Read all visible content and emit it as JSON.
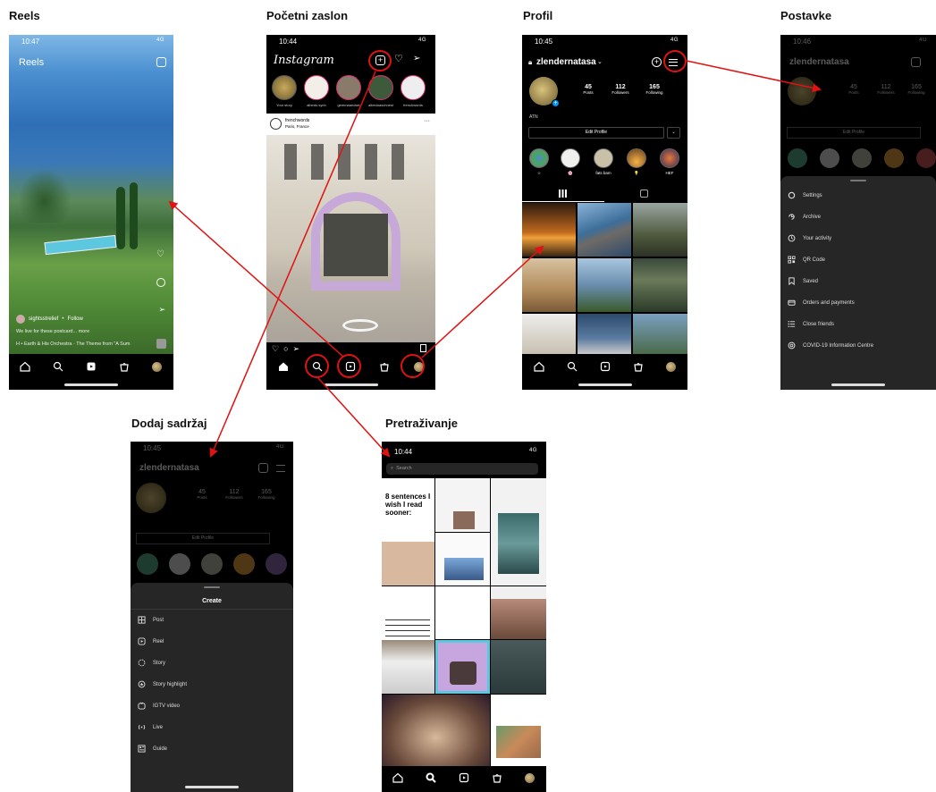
{
  "labels": {
    "reels": "Reels",
    "home": "Početni zaslon",
    "profile": "Profil",
    "settings": "Postavke",
    "add_content": "Dodaj sadržaj",
    "search": "Pretraživanje"
  },
  "reels_screen": {
    "time": "10:47",
    "signal": "4G",
    "title": "Reels",
    "username": "sightsstrelief",
    "follow": "Follow",
    "caption": "We live for these postcard... more",
    "audio": "H • Earth & His Orchestra · The Theme from \"A Sum"
  },
  "home_screen": {
    "time": "10:44",
    "signal": "4G",
    "logo": "Instagram",
    "stories": [
      "Your story",
      "albedo.syrin",
      "gemmaandwe",
      "albedoaschnest",
      "frenchwords"
    ],
    "post_user": "frenchwords",
    "post_location": "Paris, France"
  },
  "profile_screen": {
    "time": "10:45",
    "signal": "4G",
    "username": "zlendernatasa",
    "posts_count": "45",
    "posts_label": "Posts",
    "followers_count": "112",
    "followers_label": "Followers",
    "following_count": "165",
    "following_label": "Following",
    "bio": "ATN",
    "edit_profile": "Edit Profile",
    "highlights": [
      "☆",
      "🌸",
      "fats bam",
      "💡",
      "HEF"
    ]
  },
  "settings_screen": {
    "time": "10:46",
    "signal": "4G",
    "username": "zlendernatasa",
    "posts_count": "45",
    "posts_label": "Posts",
    "followers_count": "112",
    "followers_label": "Followers",
    "following_count": "165",
    "following_label": "Following",
    "edit_profile": "Edit Profile",
    "menu": [
      "Settings",
      "Archive",
      "Your activity",
      "QR Code",
      "Saved",
      "Orders and payments",
      "Close friends",
      "COVID-19 Information Centre"
    ]
  },
  "create_screen": {
    "time": "10:45",
    "signal": "4G",
    "username": "zlendernatasa",
    "posts_count": "45",
    "posts_label": "Posts",
    "followers_count": "112",
    "followers_label": "Followers",
    "following_count": "165",
    "following_label": "Following",
    "edit_profile": "Edit Profile",
    "sheet_title": "Create",
    "menu": [
      "Post",
      "Reel",
      "Story",
      "Story highlight",
      "IGTV video",
      "Live",
      "Guide"
    ]
  },
  "search_screen": {
    "time": "10:44",
    "signal": "4G",
    "search_placeholder": "Search",
    "tile_quote": "8 sentences I wish I read sooner:"
  },
  "colors": {
    "annotation": "#e01212",
    "story_ring": "#d2336f",
    "accent_blue": "#0095f6"
  }
}
